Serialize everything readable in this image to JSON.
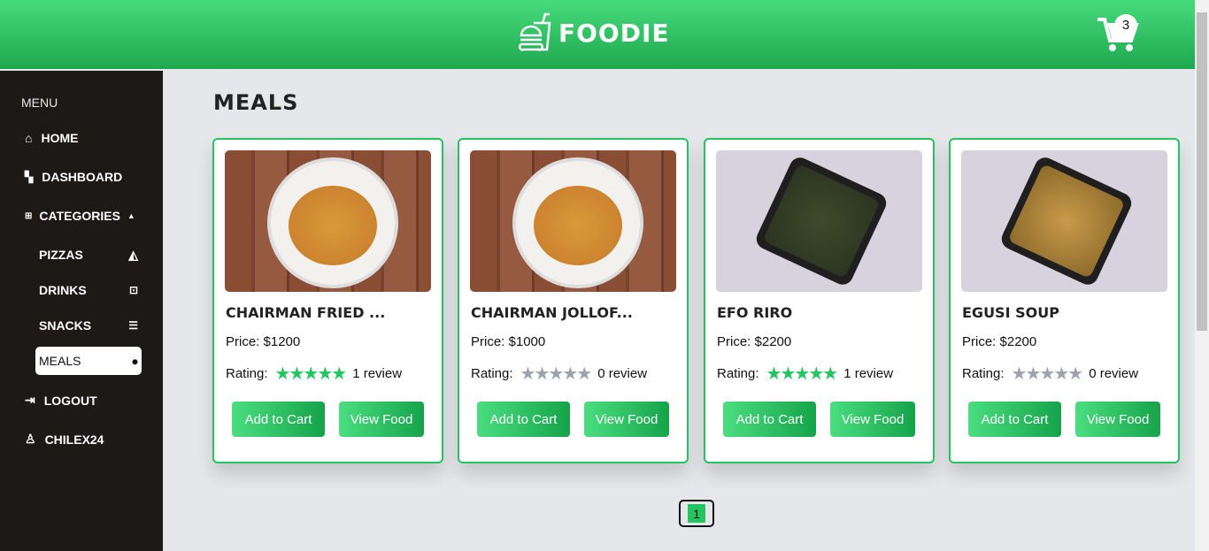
{
  "header": {
    "brand": "FOODIE",
    "cart_count": "3"
  },
  "sidebar": {
    "menu_title": "MENU",
    "home": "HOME",
    "dashboard": "DASHBOARD",
    "categories": "CATEGORIES",
    "sub": [
      "PIZZAS",
      "DRINKS",
      "SNACKS",
      "MEALS"
    ],
    "logout": "LOGOUT",
    "user": "CHILEX24"
  },
  "main": {
    "title": "MEALS",
    "price_prefix": "Price: ",
    "rating_label": "Rating:",
    "add_label": "Add to Cart",
    "view_label": "View Food",
    "items": [
      {
        "name": "CHAIRMAN FRIED ...",
        "price": "Price: $1200",
        "rating": 5,
        "stars": "★★★★★",
        "reviews": "1 review"
      },
      {
        "name": "CHAIRMAN JOLLOF...",
        "price": "Price: $1000",
        "rating": 0,
        "stars": "★★★★★",
        "reviews": "0 review"
      },
      {
        "name": "EFO RIRO",
        "price": "Price: $2200",
        "rating": 5,
        "stars": "★★★★★",
        "reviews": "1 review"
      },
      {
        "name": "EGUSI SOUP",
        "price": "Price: $2200",
        "rating": 0,
        "stars": "★★★★★",
        "reviews": "0 review"
      }
    ]
  },
  "pagination": {
    "current": "1"
  },
  "colors": {
    "accent": "#22c55e",
    "sidebar": "#1c1917",
    "background": "#e5e7eb"
  }
}
